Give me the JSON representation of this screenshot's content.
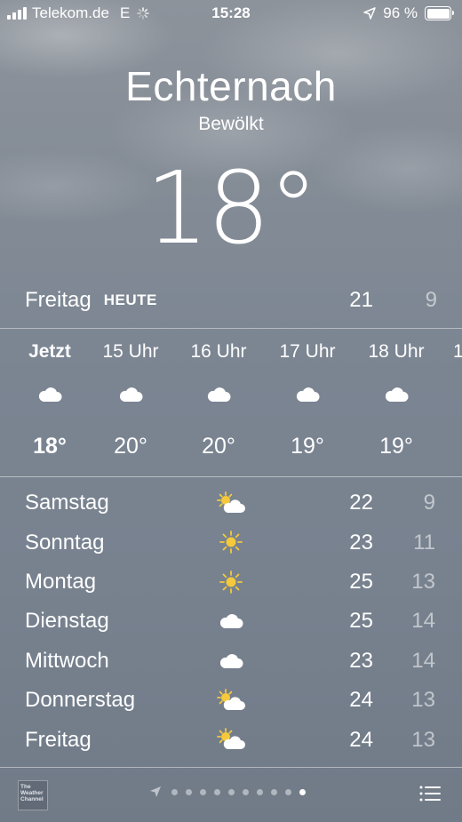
{
  "status_bar": {
    "carrier": "Telekom.de",
    "network": "E",
    "time": "15:28",
    "battery_percent": "96 %"
  },
  "location": {
    "city": "Echternach",
    "condition": "Bewölkt",
    "temperature": "18°"
  },
  "today": {
    "day": "Freitag",
    "tag": "HEUTE",
    "high": "21",
    "low": "9"
  },
  "hourly": [
    {
      "label": "Jetzt",
      "icon": "cloud-icon",
      "temp": "18°"
    },
    {
      "label": "15 Uhr",
      "icon": "cloud-icon",
      "temp": "20°"
    },
    {
      "label": "16 Uhr",
      "icon": "cloud-icon",
      "temp": "20°"
    },
    {
      "label": "17 Uhr",
      "icon": "cloud-icon",
      "temp": "19°"
    },
    {
      "label": "18 Uhr",
      "icon": "cloud-icon",
      "temp": "19°"
    },
    {
      "label": "1",
      "icon": "",
      "temp": ""
    }
  ],
  "daily": [
    {
      "day": "Samstag",
      "icon": "partly-cloudy-icon",
      "high": "22",
      "low": "9"
    },
    {
      "day": "Sonntag",
      "icon": "sun-icon",
      "high": "23",
      "low": "11"
    },
    {
      "day": "Montag",
      "icon": "sun-icon",
      "high": "25",
      "low": "13"
    },
    {
      "day": "Dienstag",
      "icon": "cloud-icon",
      "high": "25",
      "low": "14"
    },
    {
      "day": "Mittwoch",
      "icon": "cloud-icon",
      "high": "23",
      "low": "14"
    },
    {
      "day": "Donnerstag",
      "icon": "partly-cloudy-icon",
      "high": "24",
      "low": "13"
    },
    {
      "day": "Freitag",
      "icon": "partly-cloudy-icon",
      "high": "24",
      "low": "13"
    }
  ],
  "footer": {
    "logo_text": "The Weather Channel",
    "page_count": 10,
    "active_page": 10
  }
}
